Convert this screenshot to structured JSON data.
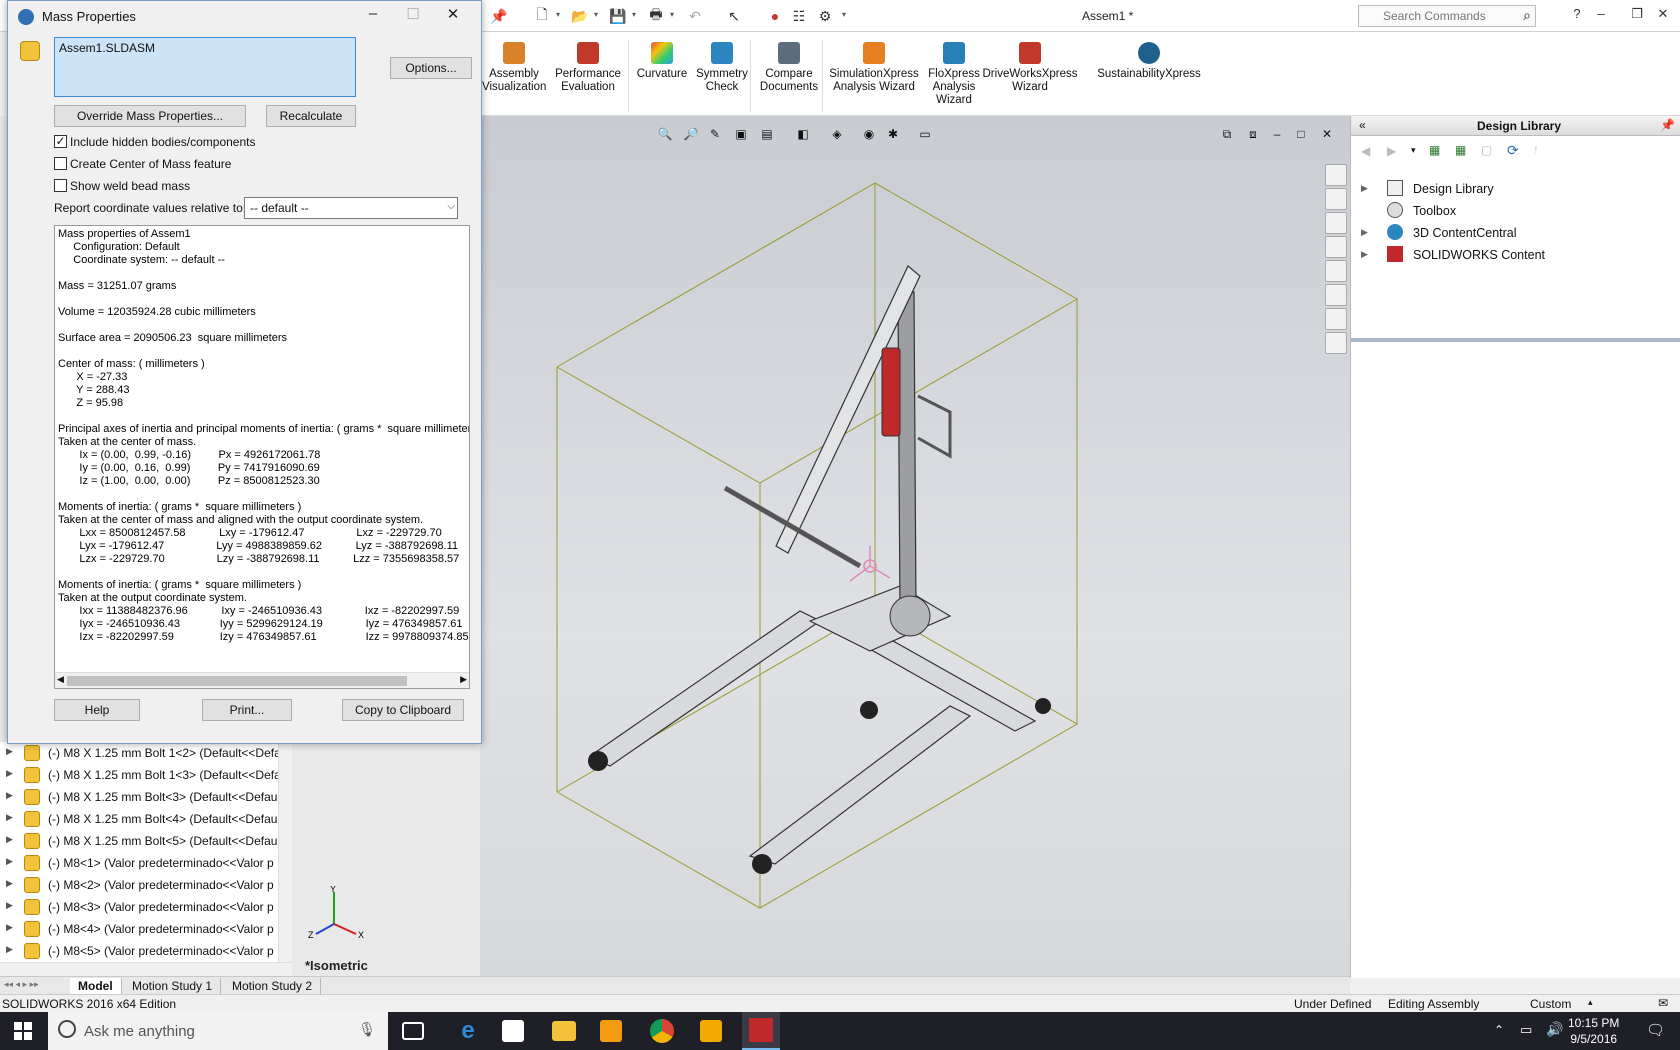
{
  "titlebar": {
    "doc_title": "Assem1 *",
    "search_placeholder": "Search Commands",
    "help_label": "?"
  },
  "ribbon": {
    "items": [
      {
        "label": "Assembly Visualization",
        "color": "#d9822b"
      },
      {
        "label": "Performance Evaluation",
        "color": "#c0392b"
      },
      {
        "label": "Curvature",
        "color": "#8e44ad"
      },
      {
        "label": "Symmetry Check",
        "color": "#2e86c1"
      },
      {
        "label": "Compare Documents",
        "color": "#5d6d7e"
      },
      {
        "label": "SimulationXpress Analysis Wizard",
        "color": "#e67e22"
      },
      {
        "label": "FloXpress Analysis Wizard",
        "color": "#2980b9"
      },
      {
        "label": "DriveWorksXpress Wizard",
        "color": "#c0392b"
      },
      {
        "label": "SustainabilityXpress",
        "color": "#1f618d"
      }
    ]
  },
  "dialog": {
    "title": "Mass Properties",
    "selection": "Assem1.SLDASM",
    "options_button": "Options...",
    "override_button": "Override Mass Properties...",
    "recalc_button": "Recalculate",
    "include_hidden": {
      "label": "Include hidden bodies/components",
      "checked": true
    },
    "create_com": {
      "label": "Create Center of Mass feature",
      "checked": false
    },
    "show_weld": {
      "label": "Show weld bead mass",
      "checked": false
    },
    "report_label": "Report coordinate values relative to:",
    "report_value": "-- default --",
    "results_text": "Mass properties of Assem1\n     Configuration: Default\n     Coordinate system: -- default --\n\nMass = 31251.07 grams\n\nVolume = 12035924.28 cubic millimeters\n\nSurface area = 2090506.23  square millimeters\n\nCenter of mass: ( millimeters )\n      X = -27.33\n      Y = 288.43\n      Z = 95.98\n\nPrincipal axes of inertia and principal moments of inertia: ( grams *  square millimeters )\nTaken at the center of mass.\n       Ix = (0.00,  0.99, -0.16)         Px = 4926172061.78\n       Iy = (0.00,  0.16,  0.99)         Py = 7417916090.69\n       Iz = (1.00,  0.00,  0.00)         Pz = 8500812523.30\n\nMoments of inertia: ( grams *  square millimeters )\nTaken at the center of mass and aligned with the output coordinate system.\n       Lxx = 8500812457.58           Lxy = -179612.47                 Lxz = -229729.70\n       Lyx = -179612.47                 Lyy = 4988389859.62           Lyz = -388792698.11\n       Lzx = -229729.70                 Lzy = -388792698.11           Lzz = 7355698358.57\n\nMoments of inertia: ( grams *  square millimeters )\nTaken at the output coordinate system.\n       Ixx = 11388482376.96           Ixy = -246510936.43              Ixz = -82202997.59\n       Iyx = -246510936.43             Iyy = 5299629124.19              Iyz = 476349857.61\n       Izx = -82202997.59               Izy = 476349857.61                Izz = 9978809374.85",
    "help_button": "Help",
    "print_button": "Print...",
    "copy_button": "Copy to Clipboard"
  },
  "tree": {
    "items": [
      "(-) M8 X 1.25 mm Bolt 1<2> (Default<<Defa",
      "(-) M8 X 1.25 mm Bolt 1<3> (Default<<Defa",
      "(-) M8 X 1.25 mm Bolt<3> (Default<<Defau",
      "(-) M8 X 1.25 mm Bolt<4> (Default<<Defau",
      "(-) M8 X 1.25 mm Bolt<5> (Default<<Defau",
      "(-) M8<1> (Valor predeterminado<<Valor p",
      "(-) M8<2> (Valor predeterminado<<Valor p",
      "(-) M8<3> (Valor predeterminado<<Valor p",
      "(-) M8<4> (Valor predeterminado<<Valor p",
      "(-) M8<5> (Valor predeterminado<<Valor p"
    ]
  },
  "viewport": {
    "view_label": "*Isometric",
    "axis_x": "X",
    "axis_y": "Y",
    "axis_z": "Z"
  },
  "tabs": [
    "Model",
    "Motion Study 1",
    "Motion Study 2"
  ],
  "design_library": {
    "title": "Design Library",
    "items": [
      {
        "label": "Design Library",
        "icon": "library-icon"
      },
      {
        "label": "Toolbox",
        "icon": "toolbox-icon"
      },
      {
        "label": "3D ContentCentral",
        "icon": "globe-icon"
      },
      {
        "label": "SOLIDWORKS Content",
        "icon": "sw-icon"
      }
    ]
  },
  "status": {
    "edition": "SOLIDWORKS 2016 x64 Edition",
    "defined": "Under Defined",
    "mode": "Editing Assembly",
    "units": "Custom"
  },
  "taskbar": {
    "search_placeholder": "Ask me anything",
    "time": "10:15 PM",
    "date": "9/5/2016"
  }
}
